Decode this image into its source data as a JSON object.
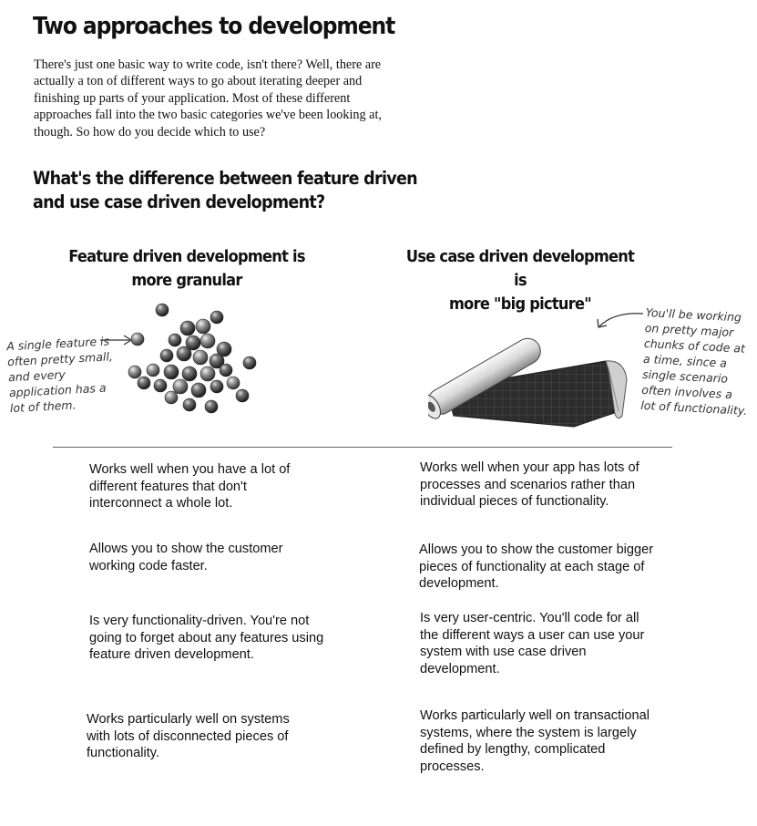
{
  "title": "Two approaches to development",
  "intro": "There's just one basic way to write code, isn't there? Well, there are actually a ton of different ways to go about iterating deeper and finishing up parts of your application. Most of these different approaches fall into the two basic categories we've been looking at, though. So how do you decide which to use?",
  "subheading": "What's the difference between feature driven and use case driven development?",
  "feature": {
    "heading_line1": "Feature driven development is",
    "heading_line2": "more granular",
    "annotation": "A single feature is often pretty small, and every application has a lot of them.",
    "points": [
      "Works well when you have a lot of different features that don't interconnect a whole lot.",
      "Allows you to show the customer working code faster.",
      "Is very functionality-driven. You're not going to forget about any features using feature driven development.",
      "Works particularly well on systems with lots of disconnected pieces of functionality."
    ]
  },
  "usecase": {
    "heading_line1": "Use case driven development is",
    "heading_line2": "more \"big picture\"",
    "annotation": "You'll be working on pretty major chunks of code at a time, since a single scenario often involves a lot of functionality.",
    "points": [
      "Works well when your app has lots of processes and scenarios rather than individual pieces of functionality.",
      "Allows you to show the customer bigger pieces of functionality at each stage of development.",
      "Is very user-centric. You'll code for all the different ways a user can use your system with use case driven development.",
      "Works particularly well on transactional systems, where the system is largely defined by lengthy, complicated processes."
    ]
  },
  "icons": {
    "feature_image": "marbles-icon",
    "usecase_image": "blueprint-scroll-icon",
    "arrow": "arrow-icon"
  }
}
